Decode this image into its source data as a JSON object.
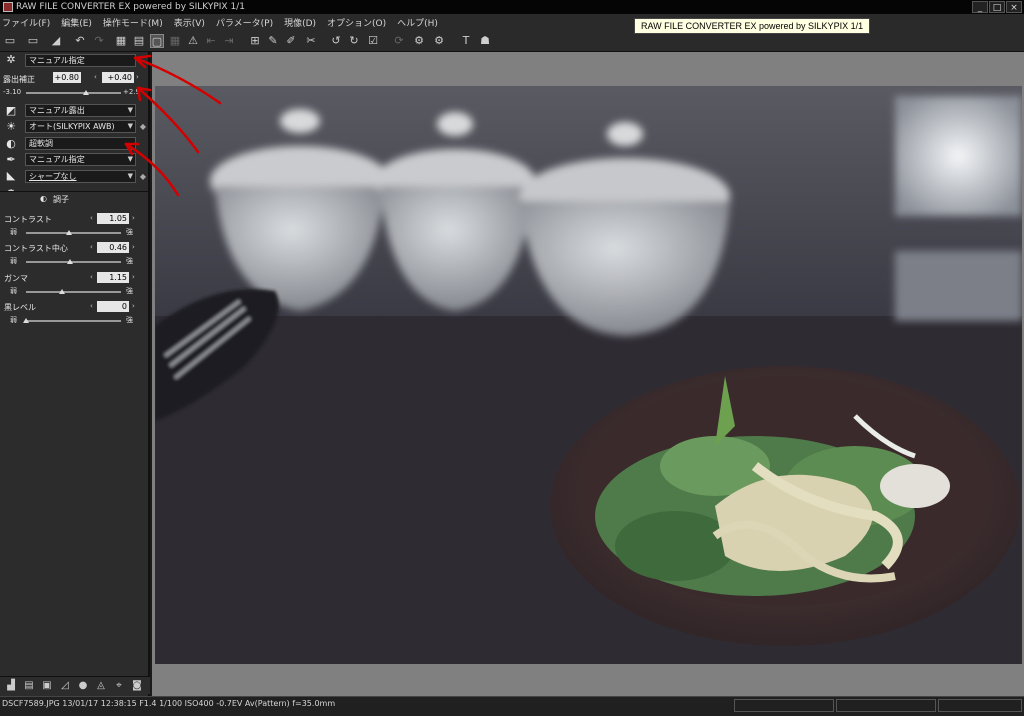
{
  "window": {
    "title": "RAW FILE CONVERTER EX powered by SILKYPIX   1/1",
    "minimize": "_",
    "maximize": "□",
    "close": "×"
  },
  "menu": [
    "ファイル(F)",
    "編集(E)",
    "操作モード(M)",
    "表示(V)",
    "パラメータ(P)",
    "現像(D)",
    "オプション(O)",
    "ヘルプ(H)"
  ],
  "tooltip": "RAW FILE CONVERTER EX powered by SILKYPIX   1/1",
  "panel": {
    "exposure_mode": "マニュアル指定",
    "exposure_label": "露出補正",
    "exposure_value_left": "+0.80",
    "exposure_value_right": "+0.40",
    "exposure_min": "-3.10",
    "exposure_max": "+2.9",
    "exposure_level": 0.63,
    "tone_mode": "マニュアル露出",
    "wb_mode": "オート(SILKYPIX AWB)",
    "contrast_mode": "超軟調",
    "color_mode": "マニュアル指定",
    "sharp_mode": "シャープなし",
    "section_title": "調子",
    "weak": "弱",
    "strong": "強",
    "contrast_label": "コントラスト",
    "contrast_value": "1.05",
    "contrast_level": 0.45,
    "contrast_center_label": "コントラスト中心",
    "contrast_center_value": "0.46",
    "contrast_center_level": 0.46,
    "gamma_label": "ガンマ",
    "gamma_value": "1.15",
    "gamma_level": 0.38,
    "black_label": "黒レベル",
    "black_value": "0",
    "black_level": 0.0
  },
  "status": {
    "text": "DSCF7589.JPG 13/01/17 12:38:15 F1.4 1/100 ISO400 -0.7EV Av(Pattern) f=35.0mm"
  },
  "icons": {
    "toolbar": [
      "open-folder-icon",
      "open-file-icon",
      "eraser-icon",
      "undo-icon",
      "redo-icon",
      "grid-view-icon",
      "filmstrip-view-icon",
      "single-view-icon",
      "compare-view-icon",
      "warning-icon",
      "rotate-left-frame-icon",
      "rotate-right-frame-icon",
      "crop-icon",
      "pen-icon",
      "eyedropper-icon",
      "brush-icon",
      "rotate-ccw-icon",
      "rotate-cw-icon",
      "checkbox-icon",
      "refresh-icon",
      "develop-icon",
      "batch-icon",
      "text-tool-icon",
      "info-icon"
    ]
  },
  "colors": {
    "panel_bg": "#2c2c2c",
    "viewer_bg": "#808080",
    "annotation_red": "#d40000",
    "tooltip_bg": "#ffffe1"
  }
}
